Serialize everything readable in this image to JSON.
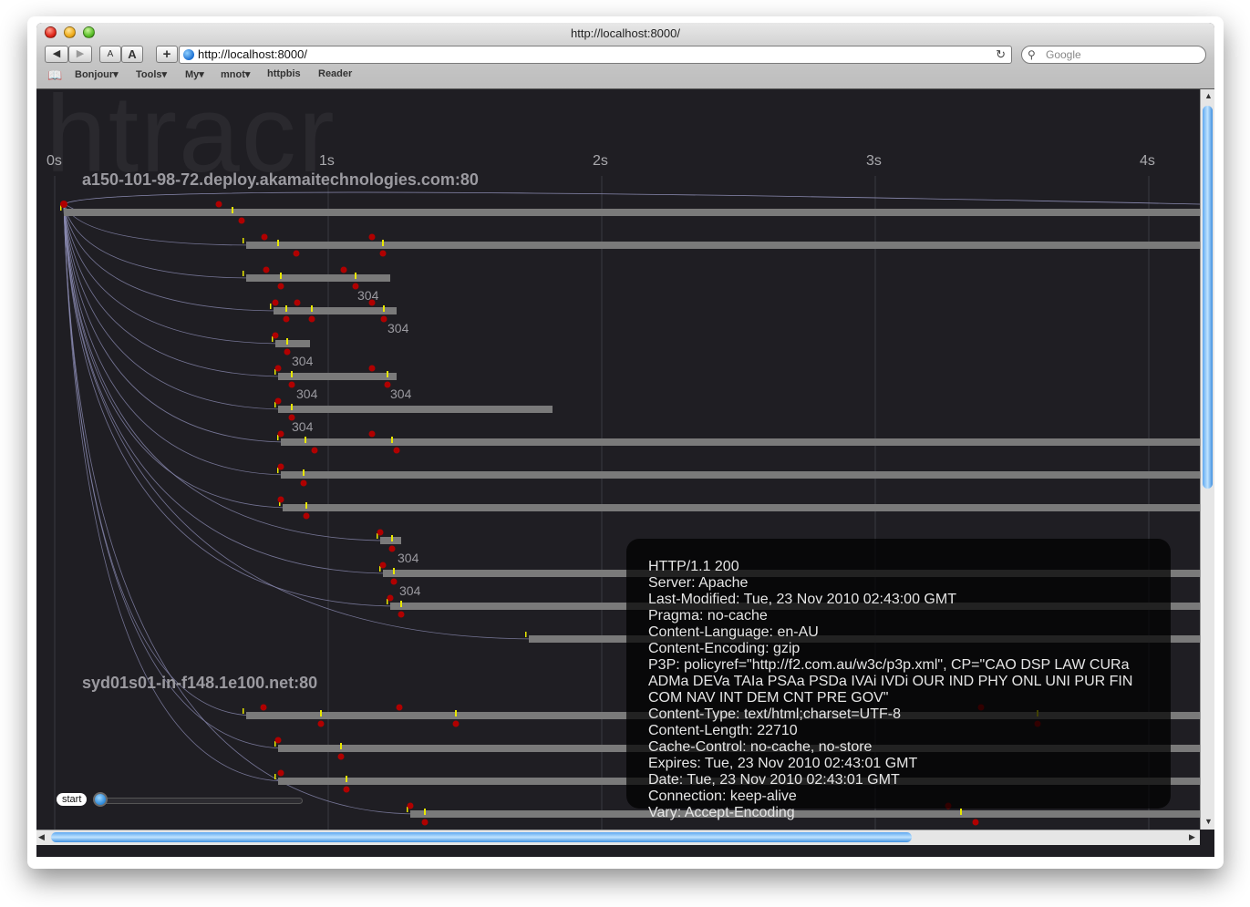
{
  "window": {
    "title": "http://localhost:8000/"
  },
  "toolbar": {
    "font_small_label": "A",
    "font_large_label": "A",
    "add_label": "+",
    "url_value": "http://localhost:8000/",
    "search_placeholder": "Google"
  },
  "bookmarks": [
    {
      "label": "Bonjour",
      "menu": true
    },
    {
      "label": "Tools",
      "menu": true
    },
    {
      "label": "My",
      "menu": true
    },
    {
      "label": "mnot",
      "menu": true
    },
    {
      "label": "httpbis",
      "menu": false
    },
    {
      "label": "Reader",
      "menu": false
    }
  ],
  "page": {
    "watermark": "htracr",
    "time_axis": [
      "0s",
      "1s",
      "2s",
      "3s",
      "4s"
    ],
    "hosts": [
      {
        "name": "a150-101-98-72.deploy.akamaitechnologies.com:80"
      },
      {
        "name": "syd01s01-in-f148.1e100.net:80"
      }
    ],
    "status_labels": [
      "304",
      "304",
      "304",
      "304",
      "304",
      "304",
      "304",
      "304",
      "304"
    ],
    "slider_label": "start",
    "tooltip_lines": [
      "HTTP/1.1 200",
      "Server: Apache",
      "Last-Modified: Tue, 23 Nov 2010 02:43:00 GMT",
      "Pragma: no-cache",
      "Content-Language: en-AU",
      "Content-Encoding: gzip",
      "P3P: policyref=\"http://f2.com.au/w3c/p3p.xml\", CP=\"CAO DSP LAW CURa ADMa DEVa TAIa PSAa PSDa IVAi IVDi OUR IND PHY ONL UNI PUR FIN COM NAV INT DEM CNT PRE GOV\"",
      "Content-Type: text/html;charset=UTF-8",
      "Content-Length: 22710",
      "Cache-Control: no-cache, no-store",
      "Expires: Tue, 23 Nov 2010 02:43:01 GMT",
      "Date: Tue, 23 Nov 2010 02:43:01 GMT",
      "Connection: keep-alive",
      "Vary: Accept-Encoding"
    ]
  },
  "colors": {
    "background": "#1f1e23",
    "bar": "#7a7a7a",
    "marker_red": "#b00000",
    "marker_yellow": "#e8e800",
    "link_line": "#8a8ab0",
    "gridline": "#3a3a40"
  }
}
